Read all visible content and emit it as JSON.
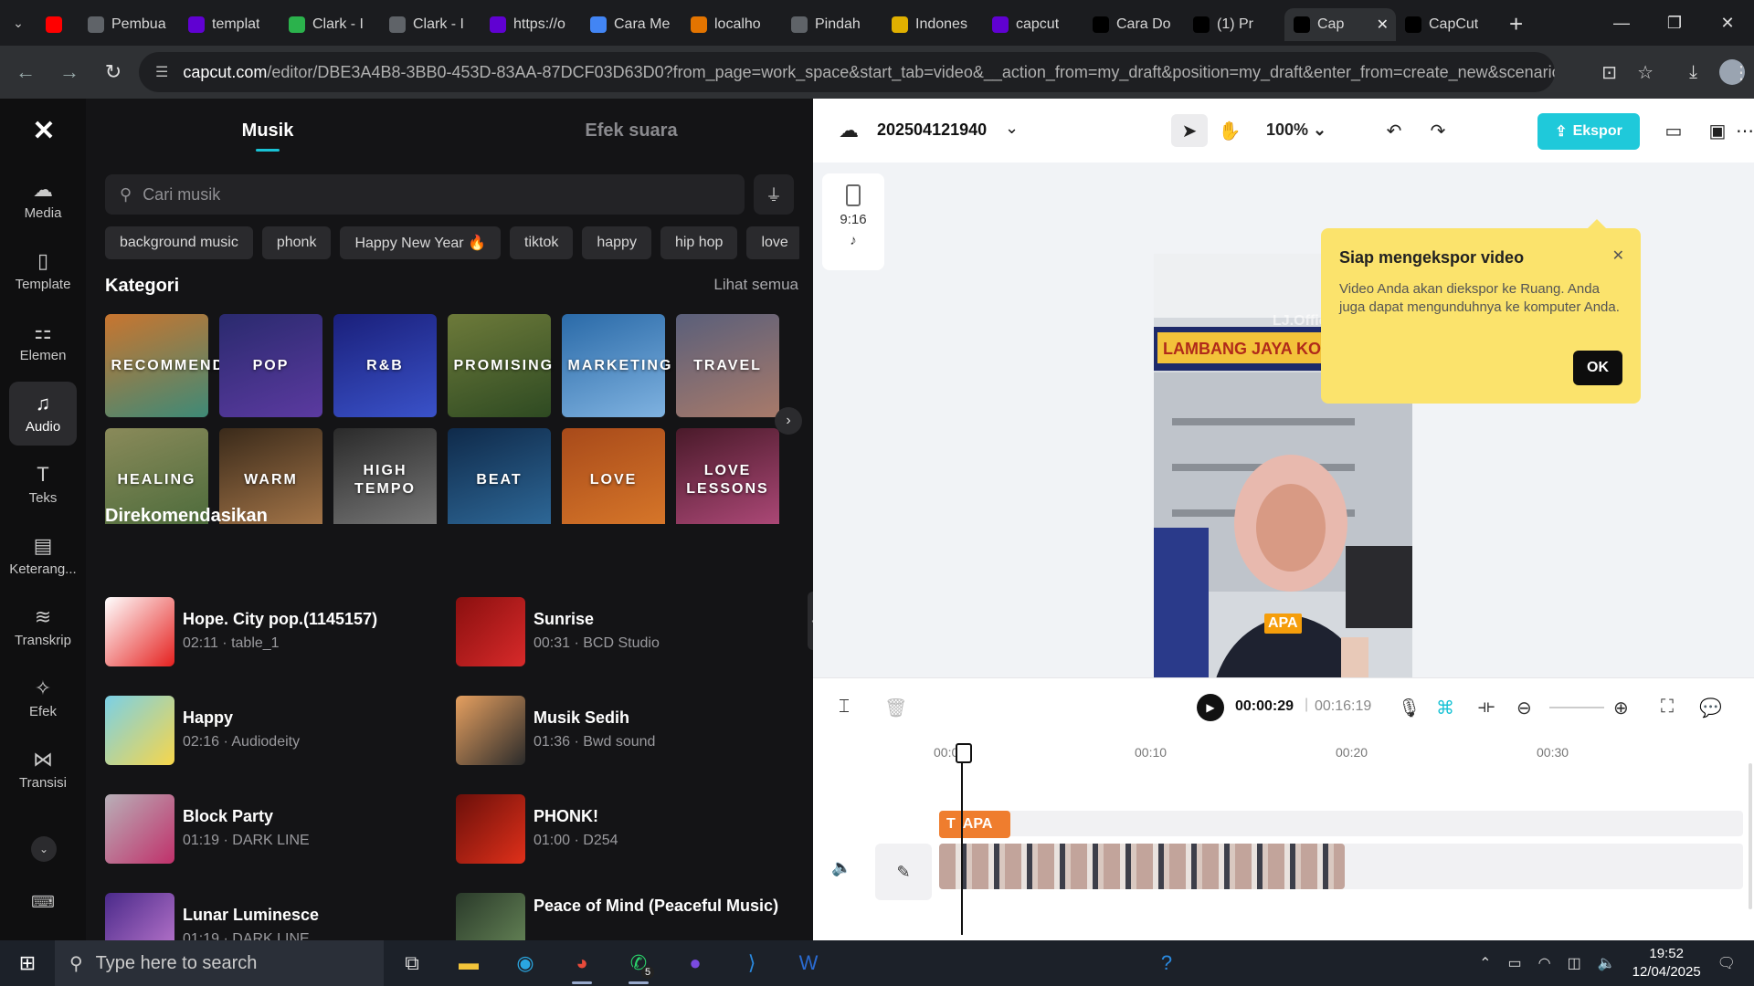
{
  "browser": {
    "tabs": [
      {
        "label": "",
        "icon": "youtube-icon",
        "color": "#ff0000"
      },
      {
        "label": "Pembua",
        "icon": "globe-icon",
        "color": "#5f6368"
      },
      {
        "label": "templat",
        "icon": "yahoo-icon",
        "color": "#6001d2"
      },
      {
        "label": "Clark - I",
        "icon": "leaf-icon",
        "color": "#2bb24c"
      },
      {
        "label": "Clark - I",
        "icon": "globe-icon",
        "color": "#5f6368"
      },
      {
        "label": "https://o",
        "icon": "yahoo-icon",
        "color": "#6001d2"
      },
      {
        "label": "Cara Me",
        "icon": "drive-icon",
        "color": "#4285f4"
      },
      {
        "label": "localho",
        "icon": "mountain-icon",
        "color": "#e37400"
      },
      {
        "label": "Pindah",
        "icon": "globe-icon",
        "color": "#5f6368"
      },
      {
        "label": "Indones",
        "icon": "flag-icon",
        "color": "#e0b000"
      },
      {
        "label": "capcut",
        "icon": "yahoo-icon",
        "color": "#6001d2"
      },
      {
        "label": "Cara Do",
        "icon": "capcut-icon",
        "color": "#000000"
      },
      {
        "label": "(1) Pr",
        "icon": "capcut-icon",
        "color": "#000000"
      },
      {
        "label": "Cap",
        "icon": "capcut-icon",
        "color": "#000000",
        "active": true
      },
      {
        "label": "CapCut",
        "icon": "capcut-icon",
        "color": "#000000"
      }
    ],
    "url_domain": "capcut.com",
    "url_rest": "/editor/DBE3A4B8-3BB0-453D-83AA-87DCF03D63D0?from_page=work_space&start_tab=video&__action_from=my_draft&position=my_draft&enter_from=create_new&scenario..."
  },
  "leftnav": {
    "items": [
      {
        "label": "Media",
        "icon": "cloud-upload-icon"
      },
      {
        "label": "Template",
        "icon": "template-icon"
      },
      {
        "label": "Elemen",
        "icon": "elements-icon"
      },
      {
        "label": "Audio",
        "icon": "music-note-icon",
        "active": true
      },
      {
        "label": "Teks",
        "icon": "text-icon"
      },
      {
        "label": "Keterang...",
        "icon": "captions-icon"
      },
      {
        "label": "Transkrip",
        "icon": "transcript-icon"
      },
      {
        "label": "Efek",
        "icon": "effects-icon"
      },
      {
        "label": "Transisi",
        "icon": "transition-icon"
      }
    ]
  },
  "panel": {
    "tabs": [
      "Musik",
      "Efek suara"
    ],
    "search_placeholder": "Cari musik",
    "chips": [
      "background music",
      "phonk",
      "Happy New Year 🔥",
      "tiktok",
      "happy",
      "hip hop",
      "love"
    ],
    "categories_title": "Kategori",
    "see_all": "Lihat semua",
    "categories": [
      {
        "label": "RECOMMEND",
        "colors": [
          "#c9752f",
          "#3e8a77"
        ]
      },
      {
        "label": "POP",
        "colors": [
          "#2a2a6e",
          "#5b3aa0"
        ]
      },
      {
        "label": "R&B",
        "colors": [
          "#1a1f7a",
          "#3a52c9"
        ]
      },
      {
        "label": "PROMISING",
        "colors": [
          "#6d7a3a",
          "#2e4a22"
        ]
      },
      {
        "label": "MARKETING",
        "colors": [
          "#2a6aa8",
          "#7fb2e0"
        ]
      },
      {
        "label": "TRAVEL",
        "colors": [
          "#5a5f7a",
          "#a87a6a"
        ]
      },
      {
        "label": "HEALING",
        "colors": [
          "#8a8a5a",
          "#4a6a3a"
        ]
      },
      {
        "label": "WARM",
        "colors": [
          "#3a2a1a",
          "#a8784a"
        ]
      },
      {
        "label": "HIGH TEMPO",
        "colors": [
          "#2a2a2a",
          "#7a7a7a"
        ]
      },
      {
        "label": "BEAT",
        "colors": [
          "#0f2a4a",
          "#2f6a9a"
        ]
      },
      {
        "label": "LOVE",
        "colors": [
          "#a84a1a",
          "#d8782a"
        ]
      },
      {
        "label": "LOVE LESSONS",
        "colors": [
          "#4a1a2a",
          "#b04a7a"
        ]
      }
    ],
    "recommended_title": "Direkomendasikan",
    "recommended": [
      {
        "title": "Hope. City pop.(1145157)",
        "meta": "02:11 · table_1",
        "thumb": [
          "#ffffff",
          "#e5201e"
        ]
      },
      {
        "title": "Sunrise",
        "meta": "00:31 · BCD Studio",
        "thumb": [
          "#8a0f0f",
          "#d82a2a"
        ]
      },
      {
        "title": "Happy",
        "meta": "02:16 · Audiodeity",
        "thumb": [
          "#7ad0e6",
          "#f7d64a"
        ]
      },
      {
        "title": "Musik Sedih",
        "meta": "01:36 · Bwd sound",
        "thumb": [
          "#e6a060",
          "#2a2a2a"
        ]
      },
      {
        "title": "Block Party",
        "meta": "01:19 · DARK LINE",
        "thumb": [
          "#b8b0b8",
          "#c0306a"
        ]
      },
      {
        "title": "PHONK!",
        "meta": "01:00 · D254",
        "thumb": [
          "#6a0f0a",
          "#e0301a"
        ]
      },
      {
        "title": "Lunar Luminesce",
        "meta": "01:19 · DARK LINE",
        "thumb": [
          "#4a2a8a",
          "#c07ad0"
        ]
      },
      {
        "title": "Peace of Mind (Peaceful Music)",
        "meta": "",
        "thumb": [
          "#2a3a2a",
          "#6a8a5a"
        ]
      }
    ]
  },
  "editor": {
    "project_name": "202504121940",
    "zoom": "100%",
    "export_label": "Ekspor",
    "ratio_label": "9:16",
    "caption_text": "APA",
    "popup": {
      "title": "Siap mengekspor video",
      "body": "Video Anda akan diekspor ke Ruang. Anda juga dapat mengunduhnya ke komputer Anda.",
      "ok": "OK"
    },
    "current_time": "00:00:29",
    "total_time": "00:16:19",
    "ruler": [
      "00:00",
      "00:10",
      "00:20",
      "00:30"
    ],
    "text_clip": "APA",
    "video_sign": "LAMBANG JAYA KOM",
    "video_watermark": "LJ.Official"
  },
  "taskbar": {
    "search_placeholder": "Type here to search",
    "whatsapp_badge": "5",
    "time": "19:52",
    "date": "12/04/2025"
  }
}
